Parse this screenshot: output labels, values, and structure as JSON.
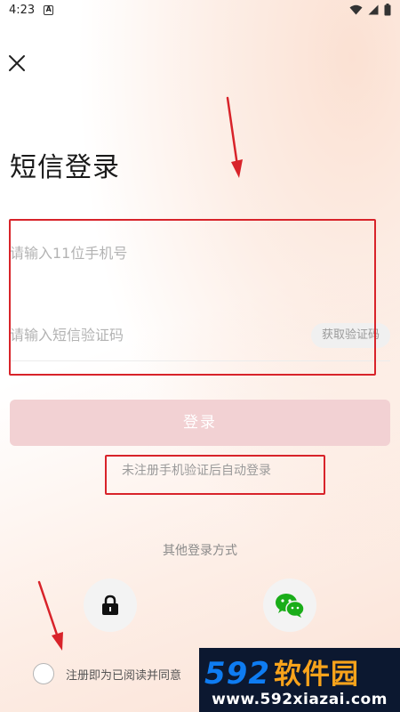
{
  "status_bar": {
    "time": "4:23",
    "notification_icon": "A"
  },
  "header": {
    "close_icon": "close-icon"
  },
  "title": "短信登录",
  "form": {
    "phone_placeholder": "请输入11位手机号",
    "phone_value": "",
    "code_placeholder": "请输入短信验证码",
    "code_value": "",
    "get_code_label": "获取验证码"
  },
  "login_button_label": "登录",
  "hint_text": "未注册手机验证后自动登录",
  "other_login": {
    "label": "其他登录方式",
    "methods": [
      {
        "icon": "lock-icon"
      },
      {
        "icon": "wechat-icon"
      }
    ]
  },
  "agreement": {
    "text": "注册即为已阅读并同意",
    "checked": false
  },
  "watermark": {
    "number": "592",
    "brand": "软件园",
    "url": "www.592xiazai.com"
  },
  "colors": {
    "annotation_red": "#d8232a",
    "login_button_disabled": "#f2d1d3",
    "wechat_green": "#1aad19",
    "watermark_blue": "#0e7cf2",
    "watermark_orange": "#f8a31b"
  }
}
